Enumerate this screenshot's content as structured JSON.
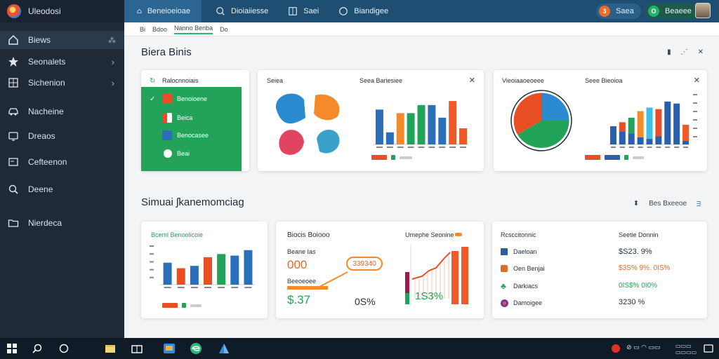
{
  "app": {
    "title": "Uleodosi"
  },
  "sidebar": {
    "items": [
      {
        "label": "Biews",
        "icon": "home-icon",
        "active": true,
        "extra": "⁂"
      },
      {
        "label": "Seonalets",
        "icon": "star-icon",
        "chevron": "›"
      },
      {
        "label": "Sichenion",
        "icon": "grid-icon",
        "chevron": "›"
      },
      {
        "label": "Nacheine",
        "icon": "car-icon"
      },
      {
        "label": "Dreaos",
        "icon": "monitor-icon"
      },
      {
        "label": "Cefteenon",
        "icon": "window-icon"
      },
      {
        "label": "Deene",
        "icon": "search-icon"
      },
      {
        "label": "Nierdeca",
        "icon": "folder-icon"
      }
    ]
  },
  "topbar": {
    "tabs": [
      {
        "label": "Beneioeioae",
        "icon": "home-icon",
        "active": true
      },
      {
        "label": "Dioiaiiesse",
        "icon": "search-icon"
      },
      {
        "label": "Saei",
        "icon": "grid-icon"
      },
      {
        "label": "Biandigee",
        "icon": "clock-icon"
      }
    ],
    "pills": [
      {
        "label": "Saea",
        "badge": "3",
        "color": "#f06a2a",
        "bg": "#2a5f88"
      },
      {
        "label": "Beaeee",
        "badge": "O",
        "color": "#23b26d",
        "bg": "#1d5a4a"
      }
    ]
  },
  "subbar": {
    "items": [
      "Bdoo",
      "Nanno Benba",
      "Do"
    ],
    "prefix": "Bi"
  },
  "sections": [
    {
      "title": "Biera Binis",
      "icons": [
        "▮",
        "⋰",
        "✕"
      ]
    },
    {
      "title": "Simuai ʃkanemomciag",
      "icons": [
        "⬍",
        "Bes Bxeeoe",
        "ᴟ"
      ]
    }
  ],
  "cards": {
    "list_card": {
      "title": "Ralocnnoiais",
      "items": [
        {
          "label": "Benoioene",
          "icon": "check-icon"
        },
        {
          "label": "Beica",
          "icon": "app-icon"
        },
        {
          "label": "Benocasee",
          "icon": "person-icon"
        },
        {
          "label": "Beai",
          "icon": "circle-icon"
        }
      ]
    },
    "pie_bar_card": {
      "title": "Seiea",
      "chart_title": "Seea Bariesiee"
    },
    "donut_card": {
      "title": "Vieoiaaoeoeee",
      "chart_title": "Seee Bieoioa"
    },
    "bar_card2": {
      "title": "Bceml Benoolicoie"
    },
    "stats_card": {
      "title": "Biocis Boiooo",
      "label1": "Beane Ias",
      "value1": "000",
      "bubble": "339340",
      "label2": "Beeoeoee",
      "value2": "$.37",
      "value3": "0S%",
      "chart_label": "Umephe Seonine",
      "bar_value": "1S3%"
    },
    "summary_card": {
      "title": "Rcsccitonnic",
      "col2_title": "Seetie Donnin",
      "rows": [
        {
          "label": "Daeloan",
          "value": "$S23. 9%",
          "color": "#2b5f9e",
          "icon": "doc-icon"
        },
        {
          "label": "Oen Benjai",
          "value": "$3S% 9%. 0IS%",
          "color": "#e06a2a",
          "icon": "bag-icon"
        },
        {
          "label": "Darkiacs",
          "value": "0IS$% 0I0%",
          "color": "#23a35a",
          "icon": "tree-icon"
        },
        {
          "label": "Damoigee",
          "value": "3230 %",
          "color": "#333333",
          "icon": "globe-icon"
        }
      ]
    }
  },
  "chart_data": [
    {
      "type": "bar",
      "values": [
        0.69,
        0.24,
        0.62,
        0.62,
        0.78,
        0.78,
        0.53,
        0.86,
        0.32
      ],
      "colors": [
        "#2a6fb8",
        "#2a6fb8",
        "#f58a2a",
        "#23a35a",
        "#23a35a",
        "#2a6fb8",
        "#2a6fb8",
        "#f05a28",
        "#f05a28"
      ]
    },
    {
      "type": "bar",
      "series": [
        {
          "values": [
            0.36,
            0.44,
            0.53,
            0.66,
            0.73,
            0.7,
            0.85,
            0.81,
            0.39
          ]
        },
        {
          "values": [
            0.16,
            0.26,
            0.22,
            0.14,
            0.11,
            0.16,
            0.0,
            0.0,
            0.07
          ]
        }
      ],
      "colors": [
        "#2a5fae",
        "#e94f25",
        "#23a35a",
        "#f58a2a",
        "#3ec1e8",
        "#e94f25",
        "#2a5fae",
        "#2a5fae",
        "#f05a28"
      ]
    },
    {
      "type": "bar",
      "values": [
        0.56,
        0.42,
        0.48,
        0.7,
        0.78,
        0.74,
        0.88
      ],
      "colors": [
        "#2a6fb8",
        "#e94f25",
        "#2a6fb8",
        "#e94f25",
        "#23a35a",
        "#2a6fb8",
        "#2a6fb8"
      ]
    }
  ]
}
